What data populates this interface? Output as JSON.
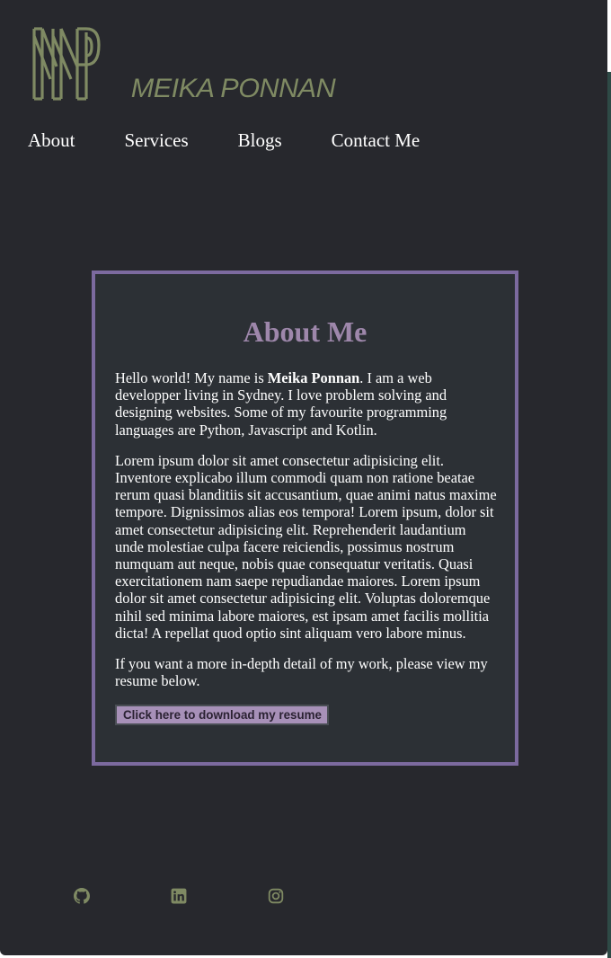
{
  "brand": {
    "logo_initials": "MP",
    "name": "MEIKA PONNAN"
  },
  "nav": {
    "items": [
      {
        "label": "About"
      },
      {
        "label": "Services"
      },
      {
        "label": "Blogs"
      },
      {
        "label": "Contact Me"
      }
    ]
  },
  "about": {
    "title": "About Me",
    "intro_before": "Hello world! My name is ",
    "intro_name": "Meika Ponnan",
    "intro_after": ". I am a web developper living in Sydney. I love problem solving and designing websites. Some of my favourite programming languages are Python, Javascript and Kotlin.",
    "paragraph2": "Lorem ipsum dolor sit amet consectetur adipisicing elit. Inventore explicabo illum commodi quam non ratione beatae rerum quasi blanditiis sit accusantium, quae animi natus maxime tempore. Dignissimos alias eos tempora! Lorem ipsum, dolor sit amet consectetur adipisicing elit. Reprehenderit laudantium unde molestiae culpa facere reiciendis, possimus nostrum numquam aut neque, nobis quae consequatur veritatis. Quasi exercitationem nam saepe repudiandae maiores. Lorem ipsum dolor sit amet consectetur adipisicing elit. Voluptas doloremque nihil sed minima labore maiores, est ipsam amet facilis mollitia dicta! A repellat quod optio sint aliquam vero labore minus.",
    "paragraph3": "If you want a more in-depth detail of my work, please view my resume below.",
    "resume_button": "Click here to download my resume"
  },
  "socials": [
    {
      "icon": "github-icon"
    },
    {
      "icon": "linkedin-icon"
    },
    {
      "icon": "instagram-icon"
    }
  ],
  "colors": {
    "page_bg": "#27282d",
    "brand_olive": "#7f8a63",
    "card_border": "#7c6a9f",
    "heading": "#9e87ab",
    "button_bg": "#a790b8"
  }
}
